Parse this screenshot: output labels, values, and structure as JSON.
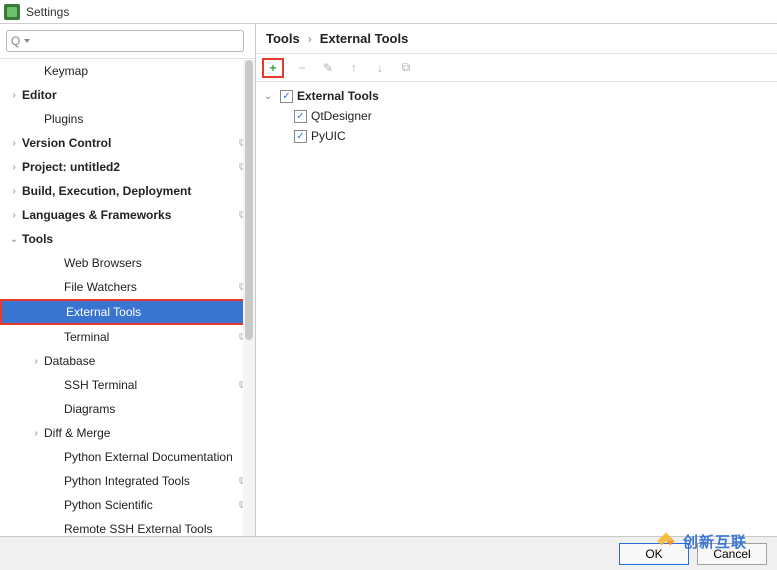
{
  "window": {
    "title": "Settings"
  },
  "search": {
    "placeholder": ""
  },
  "sidebar": {
    "items": [
      {
        "label": "Keymap",
        "indent": 1,
        "chev": "",
        "bold": false,
        "proj": false,
        "selected": false
      },
      {
        "label": "Editor",
        "indent": 0,
        "chev": "›",
        "bold": true,
        "proj": false,
        "selected": false
      },
      {
        "label": "Plugins",
        "indent": 1,
        "chev": "",
        "bold": false,
        "proj": false,
        "selected": false
      },
      {
        "label": "Version Control",
        "indent": 0,
        "chev": "›",
        "bold": true,
        "proj": true,
        "selected": false
      },
      {
        "label": "Project: untitled2",
        "indent": 0,
        "chev": "›",
        "bold": true,
        "proj": true,
        "selected": false
      },
      {
        "label": "Build, Execution, Deployment",
        "indent": 0,
        "chev": "›",
        "bold": true,
        "proj": false,
        "selected": false
      },
      {
        "label": "Languages & Frameworks",
        "indent": 0,
        "chev": "›",
        "bold": true,
        "proj": true,
        "selected": false
      },
      {
        "label": "Tools",
        "indent": 0,
        "chev": "⌄",
        "bold": true,
        "proj": false,
        "selected": false
      },
      {
        "label": "Web Browsers",
        "indent": 2,
        "chev": "",
        "bold": false,
        "proj": false,
        "selected": false
      },
      {
        "label": "File Watchers",
        "indent": 2,
        "chev": "",
        "bold": false,
        "proj": true,
        "selected": false
      },
      {
        "label": "External Tools",
        "indent": 2,
        "chev": "",
        "bold": false,
        "proj": false,
        "selected": true
      },
      {
        "label": "Terminal",
        "indent": 2,
        "chev": "",
        "bold": false,
        "proj": true,
        "selected": false
      },
      {
        "label": "Database",
        "indent": 1,
        "chev": "›",
        "bold": false,
        "proj": false,
        "selected": false
      },
      {
        "label": "SSH Terminal",
        "indent": 2,
        "chev": "",
        "bold": false,
        "proj": true,
        "selected": false
      },
      {
        "label": "Diagrams",
        "indent": 2,
        "chev": "",
        "bold": false,
        "proj": false,
        "selected": false
      },
      {
        "label": "Diff & Merge",
        "indent": 1,
        "chev": "›",
        "bold": false,
        "proj": false,
        "selected": false
      },
      {
        "label": "Python External Documentation",
        "indent": 2,
        "chev": "",
        "bold": false,
        "proj": false,
        "selected": false
      },
      {
        "label": "Python Integrated Tools",
        "indent": 2,
        "chev": "",
        "bold": false,
        "proj": true,
        "selected": false
      },
      {
        "label": "Python Scientific",
        "indent": 2,
        "chev": "",
        "bold": false,
        "proj": true,
        "selected": false
      },
      {
        "label": "Remote SSH External Tools",
        "indent": 2,
        "chev": "",
        "bold": false,
        "proj": false,
        "selected": false
      }
    ]
  },
  "breadcrumb": {
    "root": "Tools",
    "sep": "›",
    "leaf": "External Tools"
  },
  "toolbar_icons": {
    "add": "+",
    "remove": "−",
    "edit": "✎",
    "up": "↑",
    "down": "↓",
    "copy": "⧉"
  },
  "right_tree": {
    "root": {
      "label": "External Tools",
      "checked": true
    },
    "children": [
      {
        "label": "QtDesigner",
        "checked": true
      },
      {
        "label": "PyUIC",
        "checked": true
      }
    ]
  },
  "buttons": {
    "ok": "OK",
    "cancel": "Cancel"
  },
  "watermark": "创新互联"
}
